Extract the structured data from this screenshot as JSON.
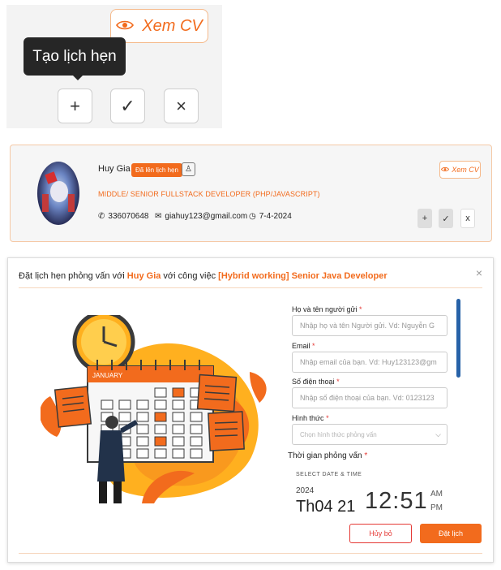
{
  "zoom": {
    "view_cv_label": "Xem CV",
    "tooltip": "Tạo lịch hẹn",
    "actions": {
      "add": "+",
      "approve": "✓",
      "reject": "×"
    }
  },
  "card": {
    "name": "Huy Gia",
    "status_badge": "Đã lên lịch hẹn",
    "job_title": "MIDDLE/ SENIOR FULLSTACK DEVELOPER (PHP/JAVASCRIPT)",
    "phone": "336070648",
    "email": "giahuy123@gmail.com",
    "date": "7-4-2024",
    "view_cv_label": "Xem CV",
    "actions": {
      "add": "+",
      "approve": "✓",
      "reject": "x"
    }
  },
  "modal": {
    "title_prefix": "Đặt lịch hẹn phỏng vấn với ",
    "candidate": "Huy Gia",
    "title_middle": " với công việc ",
    "job": "[Hybrid working] Senior Java Developer",
    "close": "×",
    "fields": {
      "sender_name": {
        "label": "Họ và tên người gửi",
        "placeholder": "Nhập họ và tên Người gửi. Vd: Nguyễn G"
      },
      "email": {
        "label": "Email",
        "placeholder": "Nhập email của bạn. Vd: Huy123123@gm"
      },
      "phone": {
        "label": "Số điện thoại",
        "placeholder": "Nhập số điện thoại của bạn. Vd: 0123123"
      },
      "format": {
        "label": "Hình thức",
        "placeholder": "Chọn hình thức phỏng vấn"
      }
    },
    "interview_time": {
      "label": "Thời gian phỏng vấn",
      "caption": "SELECT DATE & TIME",
      "year": "2024",
      "date": "Th04 21",
      "time": "12:51",
      "am": "AM",
      "pm": "PM"
    },
    "illustration": {
      "month": "JANUARY"
    },
    "cancel_label": "Hủy bỏ",
    "submit_label": "Đặt lịch"
  },
  "colors": {
    "accent": "#f26b1d",
    "danger": "#e53935",
    "scroll": "#2762a8"
  }
}
